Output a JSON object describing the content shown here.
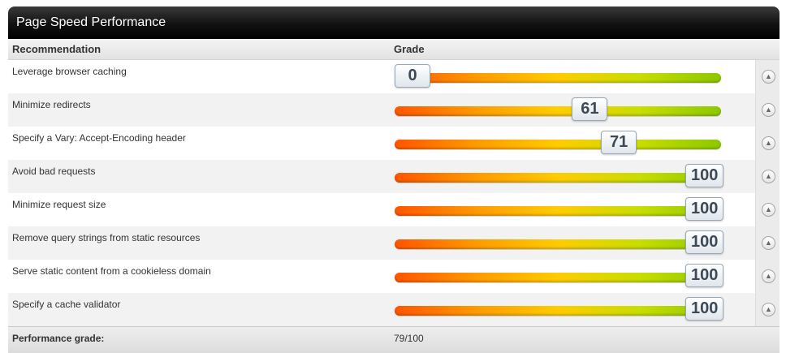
{
  "title": "Page Speed Performance",
  "columns": {
    "recommendation": "Recommendation",
    "grade": "Grade"
  },
  "rows": [
    {
      "label": "Leverage browser caching",
      "grade": "0",
      "value": 0
    },
    {
      "label": "Minimize redirects",
      "grade": "61",
      "value": 61
    },
    {
      "label": "Specify a Vary: Accept-Encoding header",
      "grade": "71",
      "value": 71
    },
    {
      "label": "Avoid bad requests",
      "grade": "100",
      "value": 100
    },
    {
      "label": "Minimize request size",
      "grade": "100",
      "value": 100
    },
    {
      "label": "Remove query strings from static resources",
      "grade": "100",
      "value": 100
    },
    {
      "label": "Serve static content from a cookieless domain",
      "grade": "100",
      "value": 100
    },
    {
      "label": "Specify a cache validator",
      "grade": "100",
      "value": 100
    }
  ],
  "footer": {
    "label": "Performance grade:",
    "value": "79/100"
  },
  "icons": {
    "expand": "chevron-up-icon"
  }
}
